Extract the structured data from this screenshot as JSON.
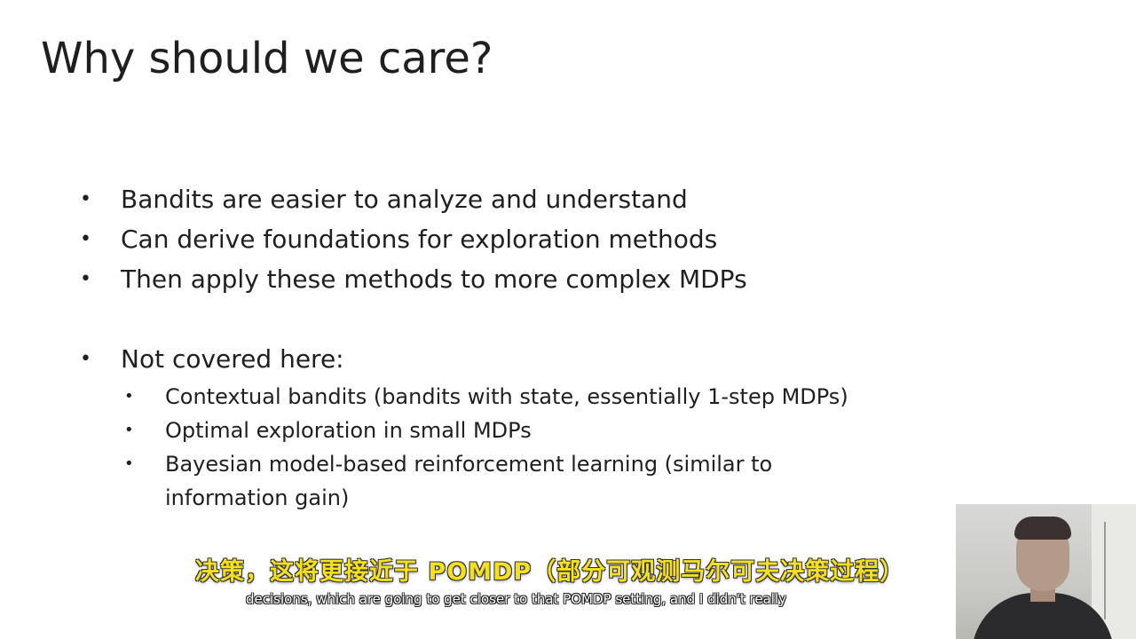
{
  "slide": {
    "title": "Why should we care?",
    "bullets": [
      "Bandits are easier to analyze and understand",
      "Can derive foundations for exploration methods",
      "Then apply these methods to more complex MDPs",
      "Not covered here:"
    ],
    "sub_bullets": [
      "Contextual bandits (bandits with state, essentially 1-step MDPs)",
      "Optimal exploration in small MDPs",
      "Bayesian model-based reinforcement learning (similar to"
    ],
    "sub_bullet_continuation": "information gain)",
    "bullet_symbol": "•"
  },
  "captions": {
    "chinese": "决策，这将更接近于 POMDP（部分可观测马尔可夫决策过程）",
    "english": "decisions, which are going to get closer to that POMDP setting, and I didn't really"
  },
  "colors": {
    "text": "#1f1f1f",
    "caption_cn": "#f5e01f",
    "caption_en": "#ffffff",
    "background": "#ffffff"
  }
}
